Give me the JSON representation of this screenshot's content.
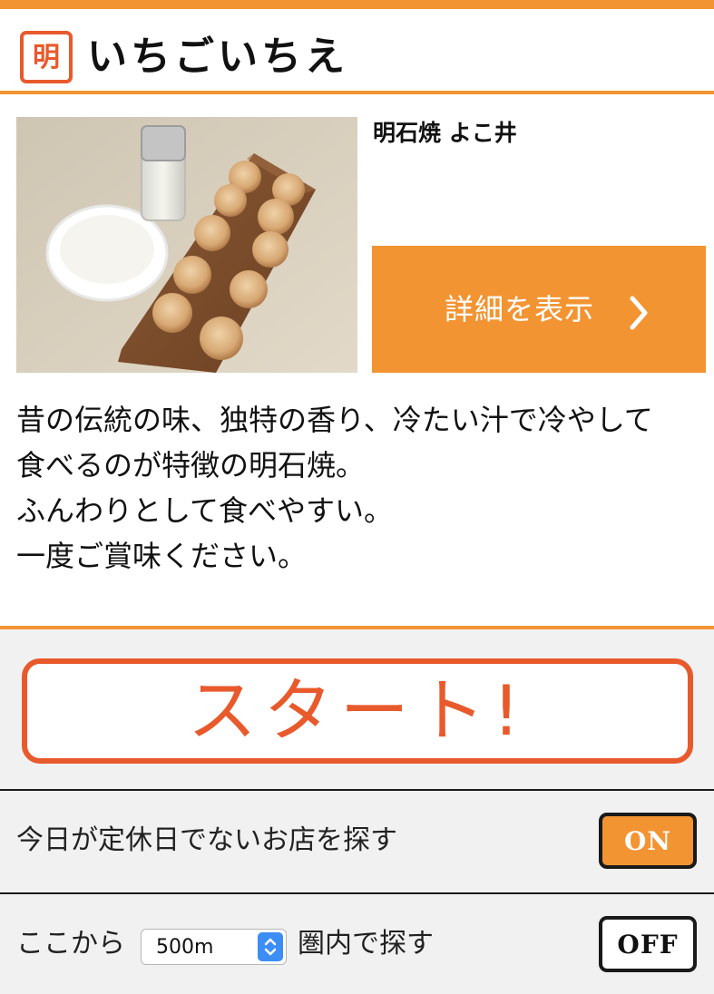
{
  "colors": {
    "accent_orange": "#f39433",
    "accent_red": "#e85a2c",
    "panel_background": "#f1f1f1"
  },
  "header": {
    "logo_char": "明",
    "title": "いちごいちえ"
  },
  "shop": {
    "name": "明石焼 よこ井",
    "detail_button_label": "詳細を表示",
    "detail_button_icon": "chevron-right-icon",
    "description_lines": [
      "昔の伝統の味、独特の香り、冷たい汁で冷やして",
      "食べるのが特徴の明石焼。",
      "ふんわりとして食べやすい。",
      "一度ご賞味ください。"
    ]
  },
  "controls": {
    "start_label": "スタート!",
    "holiday_filter": {
      "label": "今日が定休日でないお店を探す",
      "toggle": "ON"
    },
    "distance_filter": {
      "prefix": "ここから",
      "selected": "500m",
      "suffix": "圏内で探す",
      "toggle": "OFF"
    }
  }
}
